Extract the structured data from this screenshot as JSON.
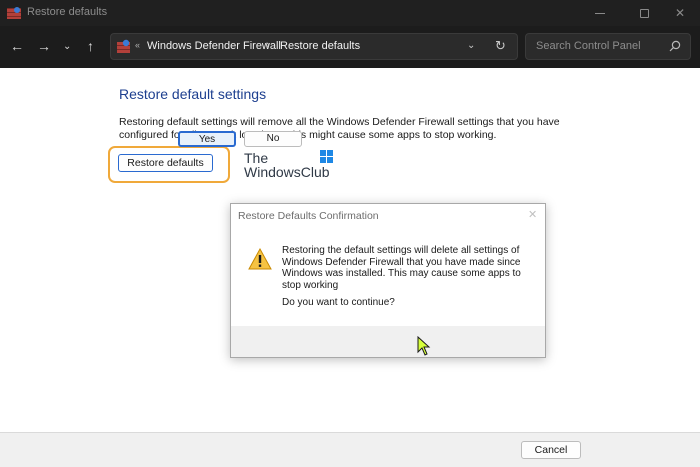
{
  "window": {
    "title": "Restore defaults",
    "icon": "firewall-icon",
    "controls": [
      "minimize-icon",
      "maximize-icon",
      "close-icon"
    ]
  },
  "nav": {
    "back_icon": "arrow-left-icon",
    "forward_icon": "arrow-right-icon",
    "recent_icon": "chevron-down-icon",
    "up_icon": "arrow-up-icon"
  },
  "address": {
    "overflow": "«",
    "crumbs": [
      "Windows Defender Firewall",
      "Restore defaults"
    ],
    "separator": "›"
  },
  "search": {
    "placeholder": "Search Control Panel"
  },
  "main": {
    "heading": "Restore default settings",
    "description": "Restoring default settings will remove all the Windows Defender Firewall settings that you have configured for all network locations. This might cause some apps to stop working.",
    "restore_button": "Restore defaults",
    "highlight_color": "#f0a93a"
  },
  "watermark": {
    "line1": "The",
    "line2": "WindowsClub"
  },
  "dialog": {
    "title": "Restore Defaults Confirmation",
    "message": "Restoring the default settings will delete all settings of Windows Defender Firewall that you have made since Windows was installed. This may cause some apps to stop working",
    "question": "Do you want to continue?",
    "yes_label": "Yes",
    "no_label": "No"
  },
  "footer": {
    "cancel_label": "Cancel"
  },
  "colors": {
    "titlebar": "#202020",
    "navbar": "#1c1c1c",
    "heading": "#1d3f8f",
    "accent": "#2a6ad0"
  }
}
